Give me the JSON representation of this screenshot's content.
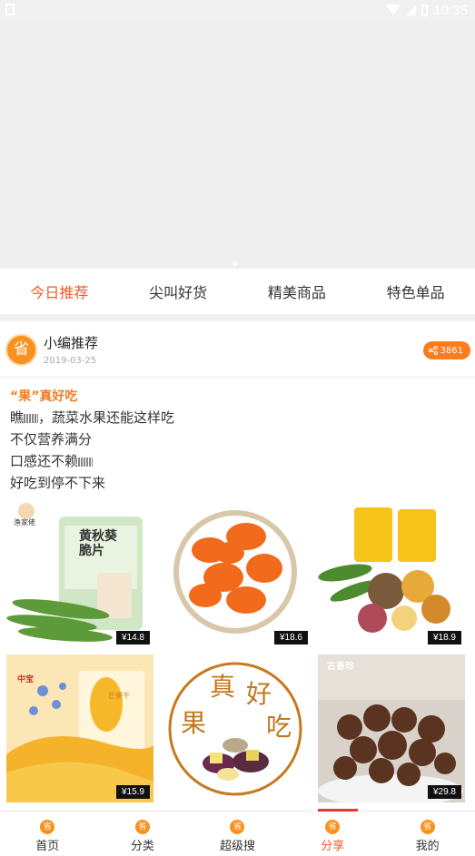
{
  "status": {
    "time": "10:35"
  },
  "tabs": [
    {
      "label": "今日推荐",
      "active": true
    },
    {
      "label": "尖叫好货",
      "active": false
    },
    {
      "label": "精美商品",
      "active": false
    },
    {
      "label": "特色单品",
      "active": false
    }
  ],
  "post": {
    "avatar_char": "省",
    "author": "小编推荐",
    "date": "2019-03-25",
    "share_count": "3861",
    "title": "“果”真好吃",
    "lines": [
      "瞧",
      "，蔬菜水果还能这样吃",
      "不仅营养满分",
      "口感还不赖",
      "好吃到停不下来"
    ]
  },
  "products": [
    {
      "price": "¥14.8",
      "label_text": "黄秋葵 脆片",
      "brand": "渔家佬"
    },
    {
      "price": "¥18.6"
    },
    {
      "price": "¥18.9"
    },
    {
      "price": "¥15.9",
      "brand": "中宝",
      "label_text": "芒果干"
    },
    {
      "banner": [
        "真",
        "好",
        "果",
        "吃"
      ]
    },
    {
      "price": "¥29.8",
      "brand": "古香珍"
    }
  ],
  "tabbar": [
    {
      "label": "首页",
      "icon": "省"
    },
    {
      "label": "分类",
      "icon": "省"
    },
    {
      "label": "超级搜",
      "icon": "省"
    },
    {
      "label": "分享",
      "icon": "省",
      "active": true
    },
    {
      "label": "我的",
      "icon": "省"
    }
  ],
  "colors": {
    "accent": "#f15a2b",
    "orange": "#f7921e",
    "share_bg": "#fb7d1e"
  }
}
